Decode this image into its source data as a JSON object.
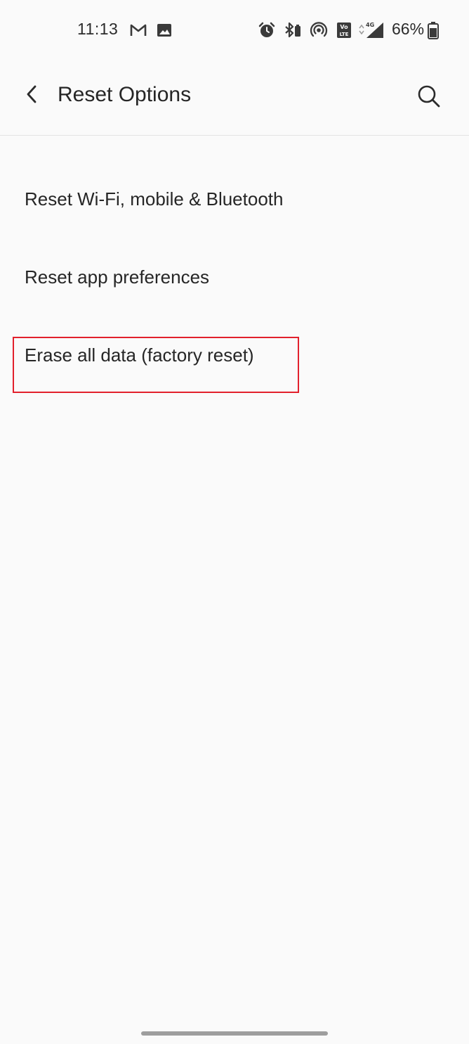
{
  "status_bar": {
    "time": "11:13",
    "battery_percent": "66%",
    "network_label": "4G",
    "icons": [
      "gmail-icon",
      "gallery-icon",
      "alarm-icon",
      "bluetooth-icon",
      "hotspot-icon",
      "volte-icon",
      "signal-icon",
      "battery-icon"
    ]
  },
  "app_bar": {
    "title": "Reset Options",
    "back_icon": "chevron-left-icon",
    "search_icon": "search-icon"
  },
  "options": [
    {
      "label": "Reset Wi-Fi, mobile & Bluetooth"
    },
    {
      "label": "Reset app preferences"
    },
    {
      "label": "Erase all data (factory reset)"
    }
  ],
  "colors": {
    "background": "#fafafa",
    "text": "#262626",
    "highlight": "#e2202c"
  }
}
